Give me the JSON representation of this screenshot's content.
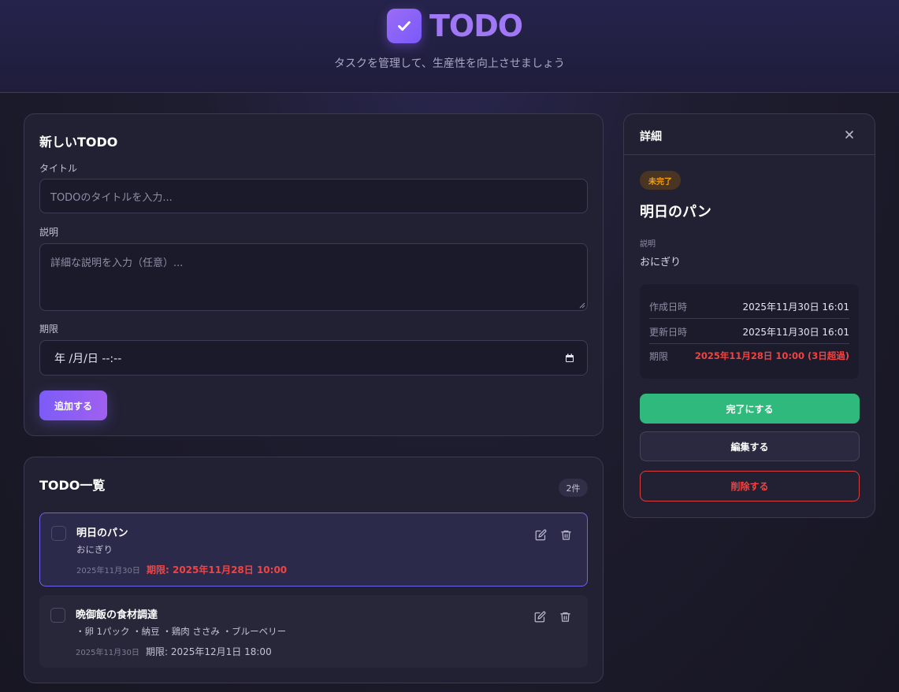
{
  "header": {
    "title": "TODO",
    "subtitle": "タスクを管理して、生産性を向上させましょう",
    "logo_icon": "check-icon"
  },
  "form": {
    "heading": "新しいTODO",
    "title_label": "タイトル",
    "title_placeholder": "TODOのタイトルを入力...",
    "desc_label": "説明",
    "desc_placeholder": "詳細な説明を入力（任意）...",
    "due_label": "期限",
    "due_value": "年 /月/日 --:--",
    "add_button": "追加する"
  },
  "list": {
    "heading": "TODO一覧",
    "count": "2件",
    "items": [
      {
        "title": "明日のパン",
        "description": "おにぎり",
        "created": "2025年11月30日",
        "due": "期限: 2025年11月28日 10:00",
        "overdue": true,
        "selected": true
      },
      {
        "title": "晩御飯の食材調達",
        "description": "・卵 1パック ・納豆 ・鶏肉 ささみ ・ブルーベリー",
        "created": "2025年11月30日",
        "due": "期限: 2025年12月1日 18:00",
        "overdue": false,
        "selected": false
      }
    ]
  },
  "detail": {
    "heading": "詳細",
    "status": "未完了",
    "title": "明日のパン",
    "desc_label": "説明",
    "description": "おにぎり",
    "meta": [
      {
        "label": "作成日時",
        "value": "2025年11月30日 16:01"
      },
      {
        "label": "更新日時",
        "value": "2025年11月30日 16:01"
      },
      {
        "label": "期限",
        "value": "2025年11月28日 10:00 (3日超過)"
      }
    ],
    "complete_button": "完了にする",
    "edit_button": "編集する",
    "delete_button": "削除する"
  },
  "colors": {
    "accent": "#8b5cf6",
    "success": "#2fb97c",
    "danger": "#ef4444",
    "warning": "#f59e0b"
  }
}
